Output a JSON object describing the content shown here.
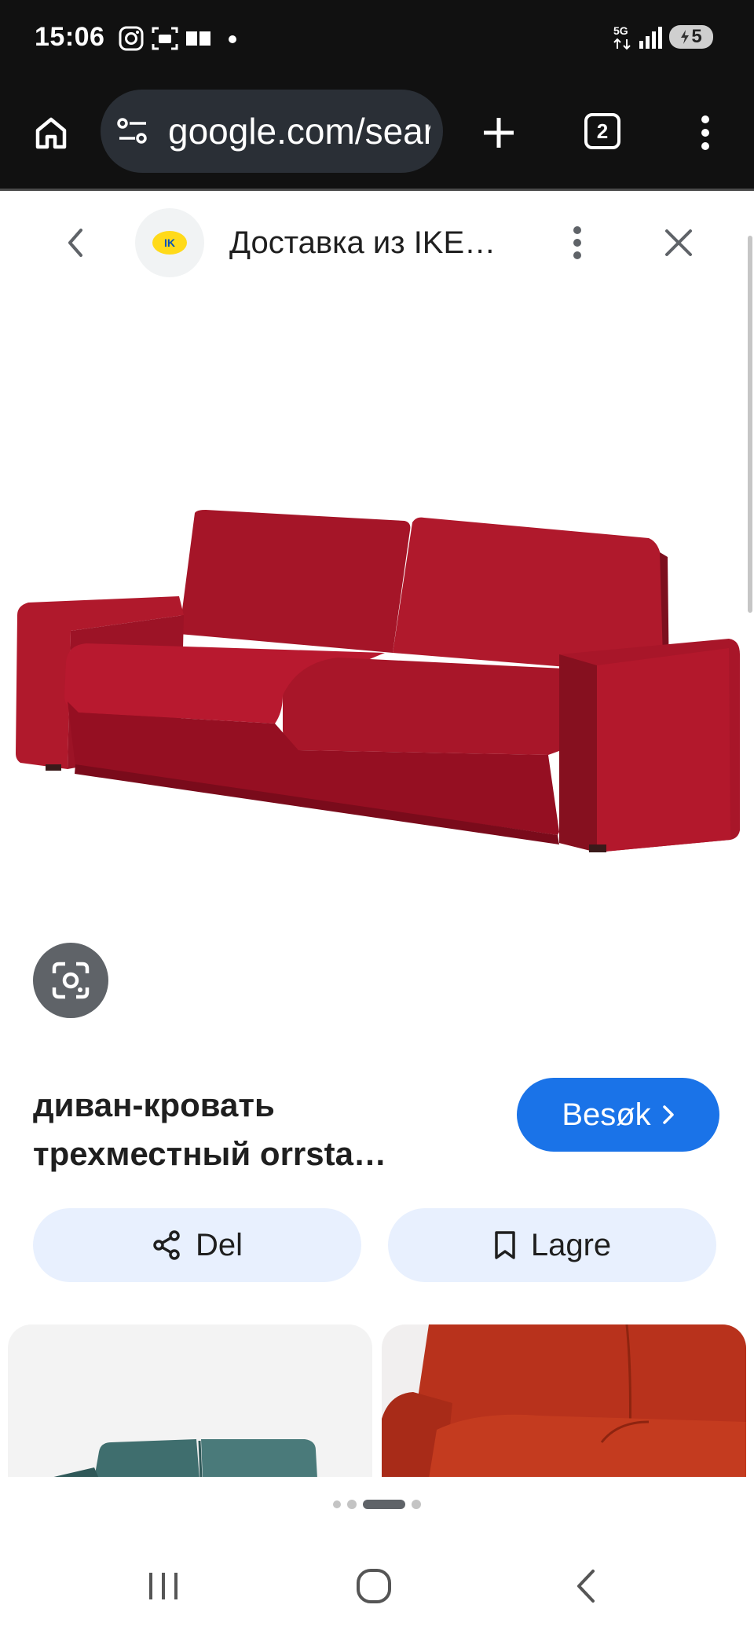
{
  "status_bar": {
    "time": "15:06",
    "network": "5G",
    "battery": "5",
    "icons": [
      "instagram-icon",
      "screen-record-icon",
      "message-icon",
      "dot-icon",
      "5g-icon",
      "signal-icon",
      "battery-icon"
    ]
  },
  "browser": {
    "url": "google.com/search",
    "tab_count": "2",
    "icons": [
      "home-icon",
      "site-settings-icon",
      "plus-icon",
      "tabs-icon",
      "more-vert-icon"
    ]
  },
  "viewer": {
    "site_name": "Доставка из IKE…",
    "logo_text": "IK",
    "icons": [
      "back-chevron-icon",
      "more-vert-icon",
      "close-icon",
      "lens-icon"
    ]
  },
  "product": {
    "title": "диван-кровать трехместный orrsta…",
    "visit_label": "Besøk",
    "share_label": "Del",
    "save_label": "Lagre"
  },
  "colors": {
    "accent": "#1a73e8",
    "pill_bg": "#e8f0fe",
    "sofa_red": "#b5182e",
    "dark_bar": "#111111"
  }
}
